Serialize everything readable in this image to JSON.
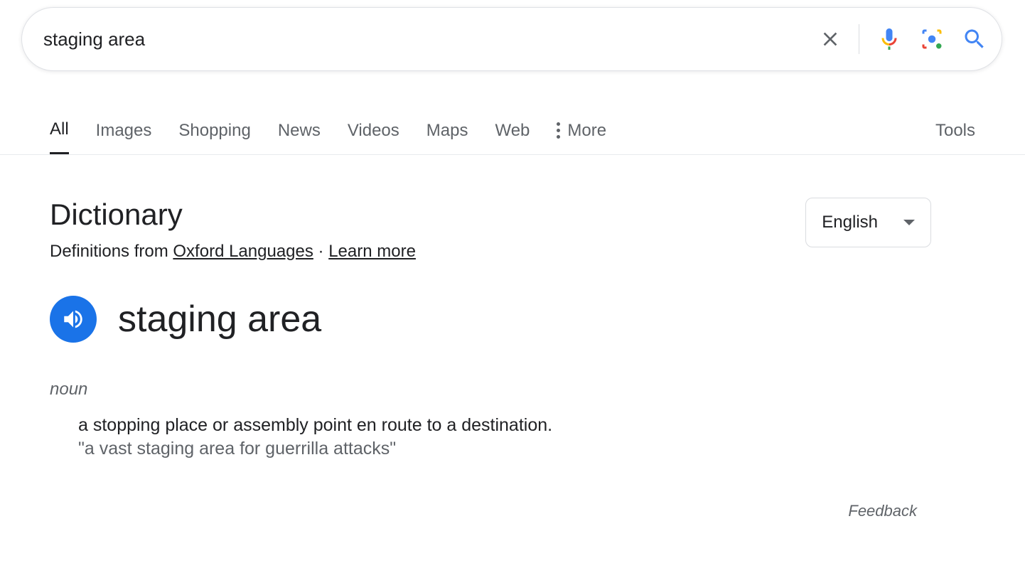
{
  "search": {
    "value": "staging area"
  },
  "tabs": {
    "items": [
      "All",
      "Images",
      "Shopping",
      "News",
      "Videos",
      "Maps",
      "Web"
    ],
    "more": "More",
    "tools": "Tools",
    "active_index": 0
  },
  "dictionary": {
    "title": "Dictionary",
    "definitions_prefix": "Definitions from ",
    "source": "Oxford Languages",
    "separator": " · ",
    "learn_more": "Learn more",
    "language": "English",
    "word": "staging area",
    "part_of_speech": "noun",
    "definition": "a stopping place or assembly point en route to a destination.",
    "example": "\"a vast staging area for guerrilla attacks\""
  },
  "feedback": "Feedback"
}
